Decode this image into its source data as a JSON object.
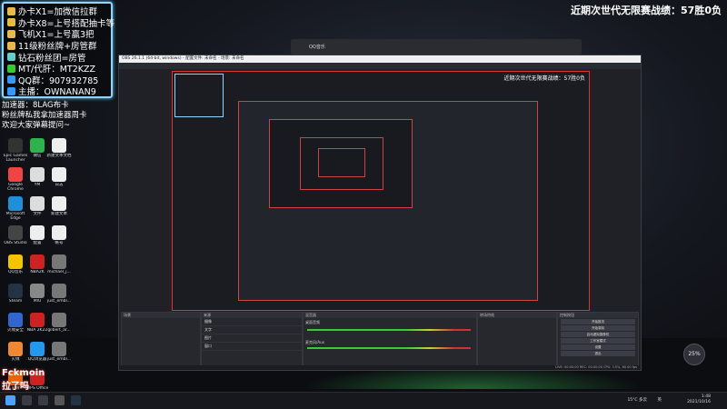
{
  "overlay": {
    "lines": [
      {
        "text": "办卡X1=加微信拉群",
        "icon_color": "#e8b84a"
      },
      {
        "text": "办卡X8=上号搭配抽卡等",
        "icon_color": "#e8b84a"
      },
      {
        "text": "飞机X1=上号赢3把",
        "icon_color": "#e8b84a"
      },
      {
        "text": "11级粉丝牌+房管群",
        "icon_color": "#e8b84a"
      },
      {
        "text": "钻石粉丝团=房管",
        "icon_color": "#6cc"
      },
      {
        "text": "MT/代肝：MT2KZZ",
        "icon_color": "#3c3"
      },
      {
        "text": "QQ群：907932785",
        "icon_color": "#39f"
      },
      {
        "text": "主播：OWNANAN9",
        "icon_color": "#39f"
      }
    ]
  },
  "note": {
    "line1": "加速器：8LAG布卡",
    "line2": "粉丝牌私我拿加速器周卡",
    "line3": "欢迎大家弹幕提问~"
  },
  "record": "近期次世代无限赛战绩：57胜0负",
  "inner_record": "近期次世代无限赛战绩：57胜0负",
  "desktop_icons": [
    {
      "label": "Epic Games Launcher",
      "color": "#333"
    },
    {
      "label": "微信",
      "color": "#2db34a"
    },
    {
      "label": "新建文本文档",
      "color": "#eee"
    },
    {
      "label": "Google Chrome",
      "color": "#e44"
    },
    {
      "label": "YM",
      "color": "#ddd"
    },
    {
      "label": "日志",
      "color": "#eee"
    },
    {
      "label": "Microsoft Edge",
      "color": "#1e8fd8"
    },
    {
      "label": "文件",
      "color": "#ddd"
    },
    {
      "label": "新建文本",
      "color": "#eee"
    },
    {
      "label": "OBS Studio",
      "color": "#444"
    },
    {
      "label": "配置",
      "color": "#eee"
    },
    {
      "label": "帐号",
      "color": "#eee"
    },
    {
      "label": "QQ音乐",
      "color": "#f5c400"
    },
    {
      "label": "NBA2K",
      "color": "#c22"
    },
    {
      "label": "michael_j...",
      "color": "#777"
    },
    {
      "label": "Steam",
      "color": "#234"
    },
    {
      "label": "MIU",
      "color": "#888"
    },
    {
      "label": "just_embl...",
      "color": "#777"
    },
    {
      "label": "火绒安全",
      "color": "#36c"
    },
    {
      "label": "NBA 2K22",
      "color": "#c22"
    },
    {
      "label": "gilbert_ar...",
      "color": "#777"
    },
    {
      "label": "火绒",
      "color": "#e83"
    },
    {
      "label": "QQ浏览器",
      "color": "#29e"
    },
    {
      "label": "just_embl...",
      "color": "#777"
    },
    {
      "label": "火绒",
      "color": "#e60"
    },
    {
      "label": "WPS Office",
      "color": "#c22"
    }
  ],
  "obs": {
    "title": "OBS 26.1.1 (64-bit, windows) - 配置文件: 未命名 - 场景: 未命名",
    "docks": [
      "场景",
      "来源",
      "混音器",
      "转场特效",
      "控制按钮"
    ],
    "sources": [
      "摄像",
      "文字",
      "图片",
      "窗口"
    ],
    "mixer": [
      "桌面音频",
      "麦克风/Aux"
    ],
    "controls": [
      "开始推流",
      "开始录制",
      "启动虚拟摄像机",
      "工作室模式",
      "设置",
      "退出"
    ],
    "status": "LIVE: 00:00:00  REC: 00:00:00  CPU: 3.5%, 60.00 fps"
  },
  "qq_title": "QQ音乐",
  "watermark": "Fckmoin\n拉了吗",
  "taskbar": {
    "time": "1:48",
    "date": "2021/10/16",
    "weather": "15°C 多云",
    "lang": "英"
  },
  "ball": "25%"
}
